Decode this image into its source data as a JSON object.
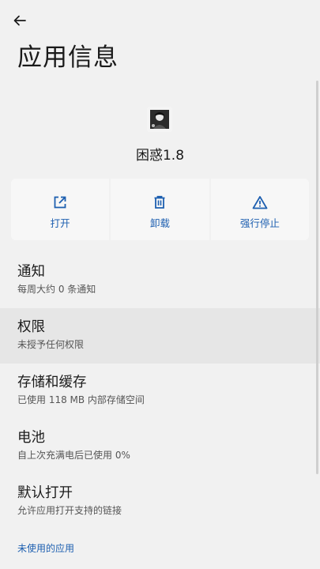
{
  "header": {
    "back_icon": "arrow-left-icon",
    "title": "应用信息"
  },
  "app": {
    "name": "困惑1.8",
    "icon": "app-avatar-icon"
  },
  "actions": [
    {
      "label": "打开",
      "icon": "open-external-icon"
    },
    {
      "label": "卸载",
      "icon": "trash-icon"
    },
    {
      "label": "强行停止",
      "icon": "warning-icon"
    }
  ],
  "settings": [
    {
      "title": "通知",
      "subtitle": "每周大约 0 条通知"
    },
    {
      "title": "权限",
      "subtitle": "未授予任何权限"
    },
    {
      "title": "存储和缓存",
      "subtitle": "已使用 118 MB 内部存储空间"
    },
    {
      "title": "电池",
      "subtitle": "自上次充满电后已使用 0%"
    },
    {
      "title": "默认打开",
      "subtitle": "允许应用打开支持的链接"
    }
  ],
  "footer": {
    "unused_apps_link": "未使用的应用"
  },
  "colors": {
    "accent": "#1d5fb0",
    "background": "#f1f1f1",
    "highlight": "#e6e6e6"
  }
}
